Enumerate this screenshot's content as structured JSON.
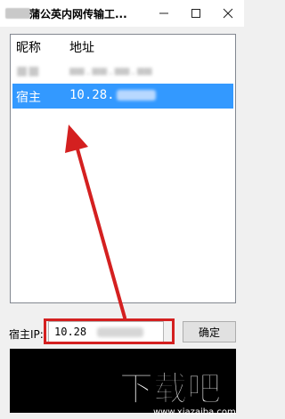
{
  "window": {
    "title": "蒲公英内网传输工..."
  },
  "titlebar_buttons": {
    "minimize": "—",
    "maximize": "☐",
    "close": "✕"
  },
  "list": {
    "headers": {
      "nickname": "昵称",
      "address": "地址"
    },
    "rows": [
      {
        "nickname": "■■",
        "address": "■■.■■.■■.■■",
        "selected": false
      },
      {
        "nickname": "宿主",
        "address": "10.28.",
        "selected": true
      }
    ]
  },
  "host_ip": {
    "label": "宿主IP:",
    "value": "10.28"
  },
  "ok_button": "确定",
  "watermark": {
    "main": "下载吧",
    "url": "www.xiazaiba.com"
  },
  "colors": {
    "selection": "#3399ff",
    "annotation": "#d42020",
    "log_background": "#000000"
  }
}
